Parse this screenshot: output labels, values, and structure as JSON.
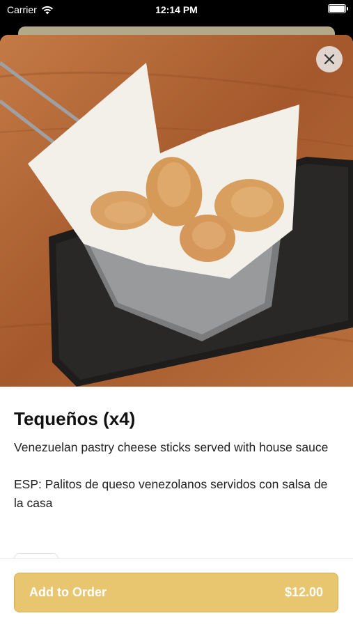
{
  "status_bar": {
    "carrier": "Carrier",
    "time": "12:14 PM"
  },
  "item": {
    "title": "Tequeños (x4)",
    "description": "Venezuelan pastry cheese sticks served with house sauce",
    "description_es": "ESP: Palitos de queso venezolanos servidos con salsa de la casa",
    "image_icon": "food-photo"
  },
  "close": {
    "icon": "close-icon"
  },
  "order_button": {
    "label": "Add to Order",
    "price": "$12.00"
  },
  "colors": {
    "accent": "#e8c670",
    "accent_border": "#d4ad4e",
    "backdrop": "#b3a98a"
  }
}
